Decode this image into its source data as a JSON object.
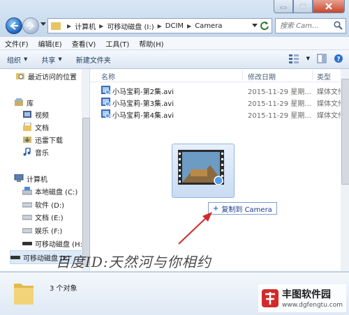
{
  "window": {
    "controls": {
      "minimize": "minimize-icon",
      "maximize": "maximize-icon",
      "close": "close-icon"
    }
  },
  "address": {
    "crumbs": [
      "计算机",
      "可移动磁盘 (I:)",
      "DCIM",
      "Camera"
    ]
  },
  "search": {
    "placeholder": "搜索 Cam..."
  },
  "menu": {
    "items": [
      "文件(F)",
      "编辑(E)",
      "查看(V)",
      "工具(T)",
      "帮助(H)"
    ]
  },
  "commands": {
    "organize": "组织",
    "share": "共享",
    "new_folder": "新建文件夹"
  },
  "nav": {
    "recent": "最近访问的位置",
    "library": "库",
    "videos": "视频",
    "documents": "文档",
    "xunlei": "迅雷下载",
    "music": "音乐",
    "computer": "计算机",
    "local_c": "本地磁盘 (C:)",
    "soft_d": "软件 (D:)",
    "docs_e": "文档 (E:)",
    "ent_f": "娱乐 (F:)",
    "removable_h": "可移动磁盘 (H:)",
    "removable_i": "可移动磁盘 (I:)"
  },
  "columns": {
    "name": "名称",
    "date": "修改日期",
    "type": "类型"
  },
  "files": [
    {
      "name": "小马宝莉-第2集.avi",
      "date": "2015-11-29 星期...",
      "type": "媒体文件"
    },
    {
      "name": "小马宝莉-第3集.avi",
      "date": "2015-11-29 星期...",
      "type": "媒体文件"
    },
    {
      "name": "小马宝莉-第4集.avi",
      "date": "2015-11-29 星期...",
      "type": "媒体文件"
    }
  ],
  "drag": {
    "tooltip": "复制到 Camera"
  },
  "details": {
    "count": "3 个对象"
  },
  "overlay": {
    "watermark": "百度ID:天然河与你相约",
    "site_name": "丰图软件园",
    "site_url": "www.dgfengtu.com"
  },
  "colors": {
    "accent": "#1e6ad8",
    "selection": "#dce9f8",
    "arrow": "#d42a2a"
  }
}
